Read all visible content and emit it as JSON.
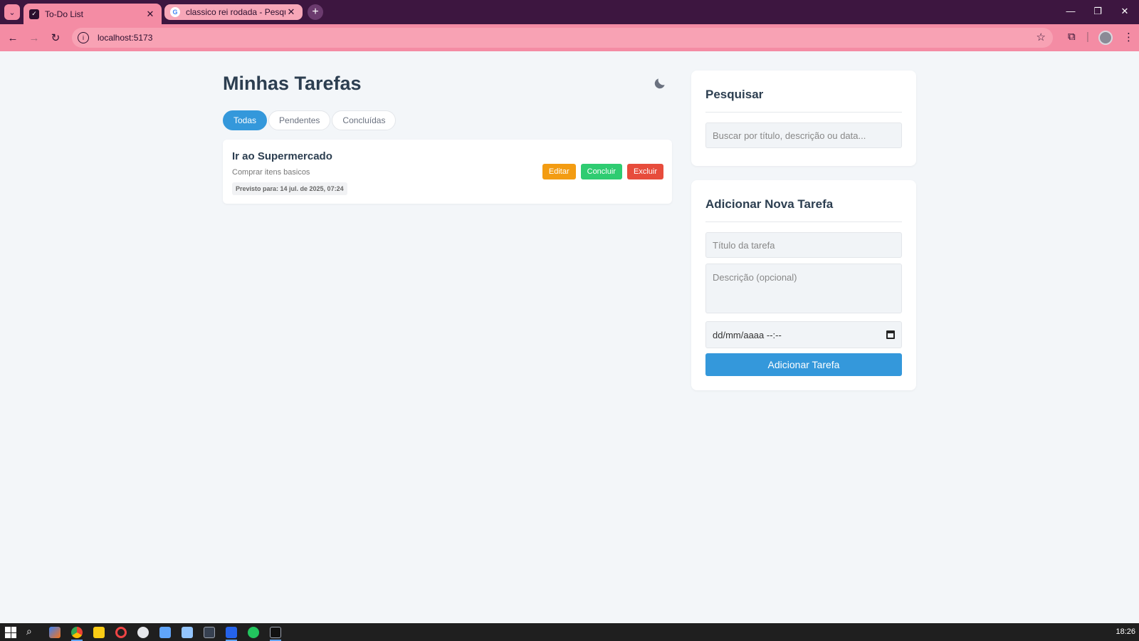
{
  "browser": {
    "tabs": [
      {
        "title": "To-Do List",
        "active": true,
        "favicon": "todo-favicon-icon"
      },
      {
        "title": "classico rei rodada - Pesquisa G",
        "active": false,
        "favicon": "google-favicon-icon"
      }
    ],
    "new_tab_icon": "+",
    "url": "localhost:5173",
    "accent_color": "#f48ca4",
    "frame_color": "#3d1640"
  },
  "page": {
    "title": "Minhas Tarefas",
    "filters": [
      {
        "label": "Todas",
        "active": true
      },
      {
        "label": "Pendentes",
        "active": false
      },
      {
        "label": "Concluídas",
        "active": false
      }
    ],
    "tasks": [
      {
        "title": "Ir ao Supermercado",
        "description": "Comprar itens basicos",
        "due": "Previsto para: 14 jul. de 2025, 07:24",
        "actions": {
          "edit": "Editar",
          "complete": "Concluir",
          "delete": "Excluir"
        }
      }
    ]
  },
  "search_panel": {
    "title": "Pesquisar",
    "placeholder": "Buscar por título, descrição ou data..."
  },
  "add_panel": {
    "title": "Adicionar Nova Tarefa",
    "title_placeholder": "Título da tarefa",
    "description_placeholder": "Descrição (opcional)",
    "date_placeholder": "dd/mm/aaaa --:--",
    "submit_label": "Adicionar Tarefa"
  },
  "colors": {
    "primary": "#3498db",
    "edit": "#f39c12",
    "complete": "#2ecc71",
    "delete": "#e74c3c",
    "heading": "#2c3e50",
    "background": "#f3f6f9"
  },
  "taskbar": {
    "clock": "18:26"
  }
}
